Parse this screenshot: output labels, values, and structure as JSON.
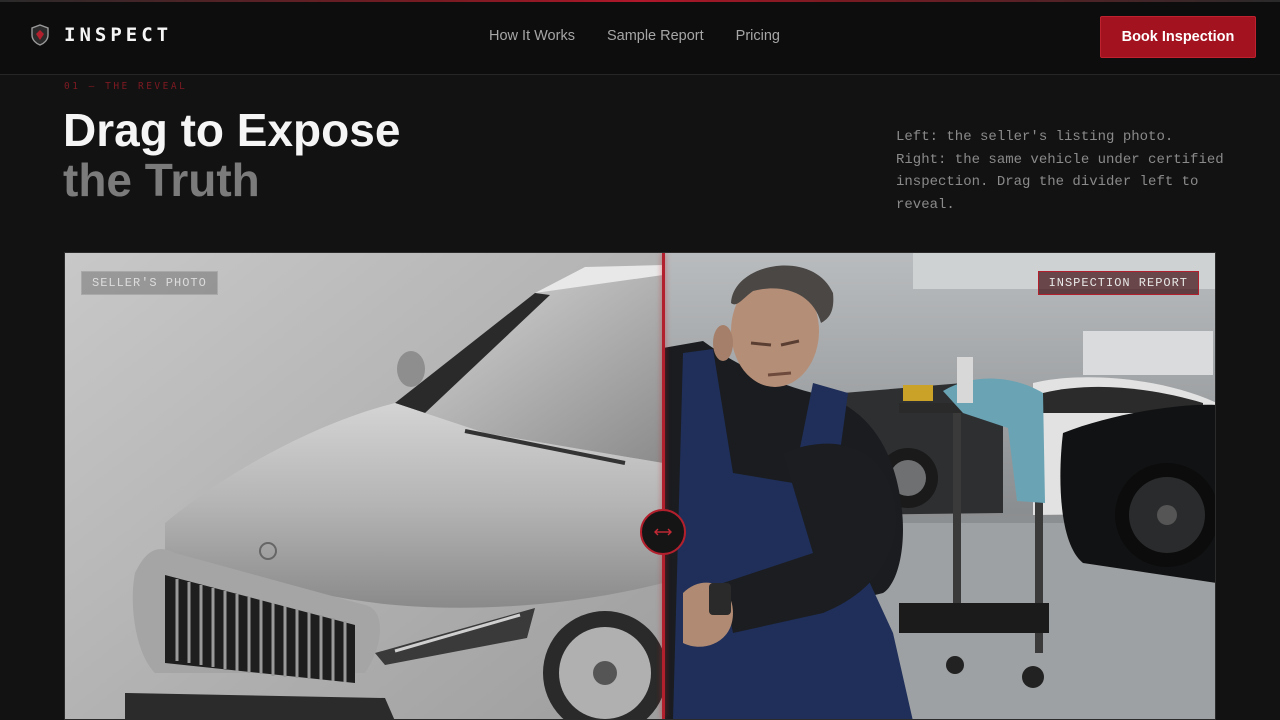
{
  "brand": {
    "name": "INSPECT",
    "logo_icon": "shield-icon"
  },
  "nav": {
    "items": [
      {
        "label": "How It Works"
      },
      {
        "label": "Sample Report"
      },
      {
        "label": "Pricing"
      }
    ]
  },
  "cta": {
    "label": "Book Inspection"
  },
  "section": {
    "eyebrow": "01 — THE REVEAL",
    "title_line1": "Drag to Expose",
    "title_line2": "the Truth",
    "description": "Left: the seller's listing photo. Right: the same vehicle under certified inspection. Drag the divider left to reveal."
  },
  "compare": {
    "left_label": "SELLER'S PHOTO",
    "right_label": "INSPECTION REPORT",
    "handle_icon": "drag-arrows-icon",
    "divider_position_percent": 52
  },
  "colors": {
    "accent": "#a3121f",
    "background": "#121212",
    "header": "#0d0d0d",
    "muted_text": "#8a8a8a"
  }
}
